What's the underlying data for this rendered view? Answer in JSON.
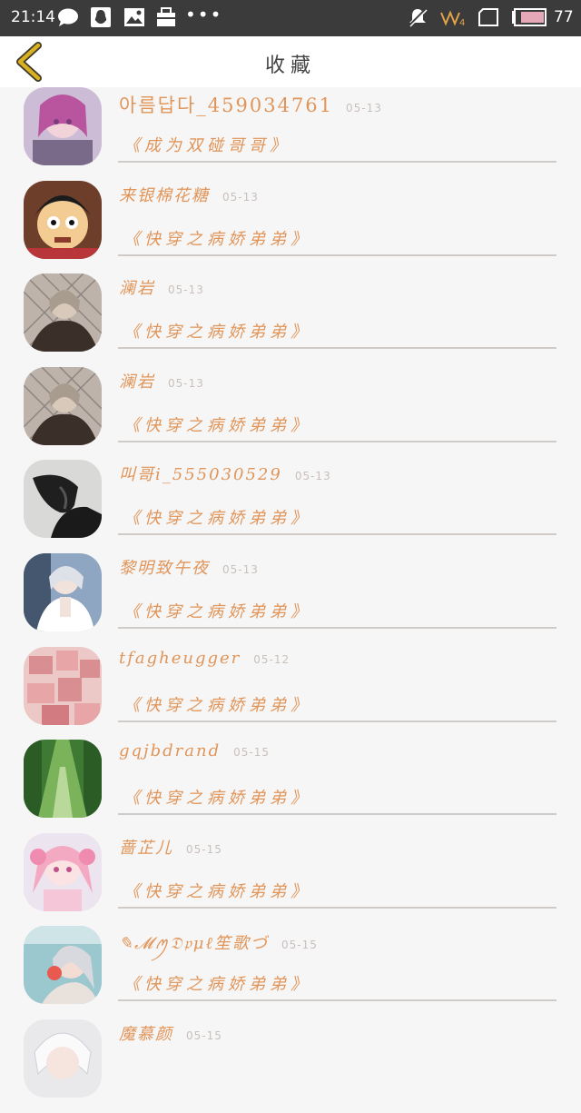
{
  "status_bar": {
    "time": "21:14",
    "dots": "•••",
    "battery": "77",
    "icons": [
      "message-icon",
      "penguin-icon",
      "image-icon",
      "bag-icon",
      "more-dots-icon",
      "mute-icon",
      "signal-icon",
      "sim-icon",
      "battery-icon"
    ]
  },
  "header": {
    "title": "收藏",
    "back_icon": "chevron-left-icon",
    "accent": "#d9a521"
  },
  "colors": {
    "text_accent": "#e0955a",
    "date": "#c8c0bb",
    "divider": "#cfcbc8",
    "background": "#f7f6f6"
  },
  "favorites": [
    {
      "user": "아름답다_459034761",
      "date": "05-13",
      "book": "《成为双碰哥哥》",
      "avatar": "anime-girl-purple"
    },
    {
      "user": "来银棉花糖",
      "date": "05-13",
      "book": "《快穿之病娇弟弟》",
      "avatar": "pirate-boy"
    },
    {
      "user": "澜岩",
      "date": "05-13",
      "book": "《快穿之病娇弟弟》",
      "avatar": "anime-boy-fence"
    },
    {
      "user": "澜岩",
      "date": "05-13",
      "book": "《快穿之病娇弟弟》",
      "avatar": "anime-boy-fence"
    },
    {
      "user": "叫哥i_555030529",
      "date": "05-13",
      "book": "《快穿之病娇弟弟》",
      "avatar": "bw-silhouette"
    },
    {
      "user": "黎明致午夜",
      "date": "05-13",
      "book": "《快穿之病娇弟弟》",
      "avatar": "anime-boy-white"
    },
    {
      "user": "tfagheugger",
      "date": "05-12",
      "book": "《快穿之病娇弟弟》",
      "avatar": "pink-boxes"
    },
    {
      "user": "gqjbdrand",
      "date": "05-15",
      "book": "《快穿之病娇弟弟》",
      "avatar": "green-path"
    },
    {
      "user": "蔷芷儿",
      "date": "05-15",
      "book": "《快穿之病娇弟弟》",
      "avatar": "anime-girl-pink"
    },
    {
      "user": "✎𝓜ꪑ𝔇𝔭μℓ笙歌づ",
      "date": "05-15",
      "book": "《快穿之病娇弟弟》",
      "avatar": "anime-boy-silver"
    },
    {
      "user": "魔慕颜",
      "date": "05-15",
      "book": "",
      "avatar": "anime-white-hair"
    }
  ]
}
